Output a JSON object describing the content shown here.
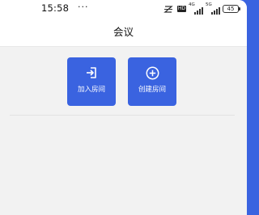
{
  "status_bar": {
    "time": "15:58",
    "more": "···",
    "network_tag_1": "4G",
    "network_tag_2": "5G",
    "hd_label": "HD",
    "battery": "45"
  },
  "nav": {
    "title": "会议"
  },
  "actions": {
    "join_label": "加入房间",
    "create_label": "创建房间"
  },
  "colors": {
    "accent": "#3a63e0",
    "background": "#f2f2f2",
    "bar": "#ffffff"
  },
  "icons": {
    "join": "login-icon",
    "create": "add-circle-icon"
  }
}
